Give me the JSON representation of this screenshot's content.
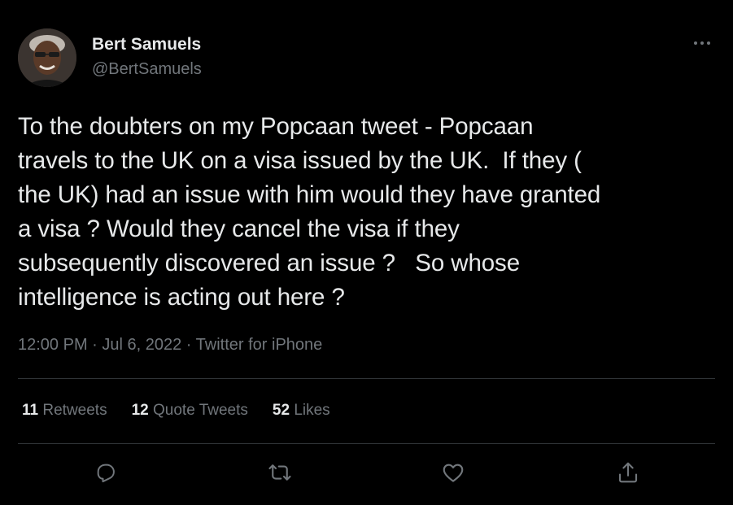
{
  "author": {
    "display_name": "Bert Samuels",
    "handle": "@BertSamuels",
    "avatar_icon": "profile-photo"
  },
  "tweet": {
    "text": "To the doubters on my Popcaan tweet - Popcaan\ntravels to the UK on a visa issued by the UK.  If they (\nthe UK) had an issue with him would they have granted\na visa ? Would they cancel the visa if they\nsubsequently discovered an issue ?   So whose\nintelligence is acting out here ?",
    "time": "12:00 PM",
    "date": "Jul 6, 2022",
    "separator": " · ",
    "source": "Twitter for iPhone"
  },
  "stats": {
    "retweets": {
      "count": "11",
      "label": "Retweets"
    },
    "quote_tweets": {
      "count": "12",
      "label": "Quote Tweets"
    },
    "likes": {
      "count": "52",
      "label": "Likes"
    }
  },
  "actions": [
    "reply-icon",
    "retweet-icon",
    "like-icon",
    "share-icon"
  ],
  "colors": {
    "background": "#000000",
    "primary_text": "#e7e9ea",
    "secondary_text": "#71767b",
    "divider": "#2f3336"
  }
}
